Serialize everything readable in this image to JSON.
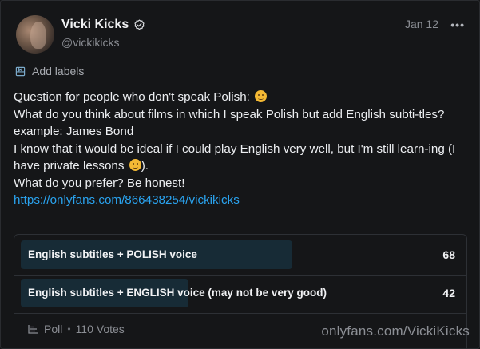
{
  "post": {
    "author_name": "Vicki Kicks",
    "author_handle": "@vickikicks",
    "date": "Jan 12",
    "more_icon": "more-horizontal-icon",
    "add_labels": "Add labels",
    "lines": [
      "Question for people who don't speak Polish:",
      "What do you think about films in which I speak Polish but add English subti-tles? example: James Bond",
      "I know that it would be ideal if I could play English very well, but I'm still learn-ing (I have private lessons",
      ").",
      "What do you prefer? Be honest!"
    ],
    "link": "https://onlyfans.com/866438254/vickikicks"
  },
  "poll": {
    "options": [
      {
        "label": "English subtitles + POLISH voice",
        "votes": "68",
        "fraction": 0.618
      },
      {
        "label": "English subtitles + ENGLISH voice (may not be very good)",
        "votes": "42",
        "fraction": 0.382
      }
    ],
    "type_label": "Poll",
    "separator": "•",
    "total_votes": "110 Votes"
  },
  "watermark": "onlyfans.com/VickiKicks",
  "colors": {
    "background": "#151618",
    "link": "#2aa3ef",
    "poll_fill": "#172b36",
    "muted_text": "#8a8d93"
  }
}
